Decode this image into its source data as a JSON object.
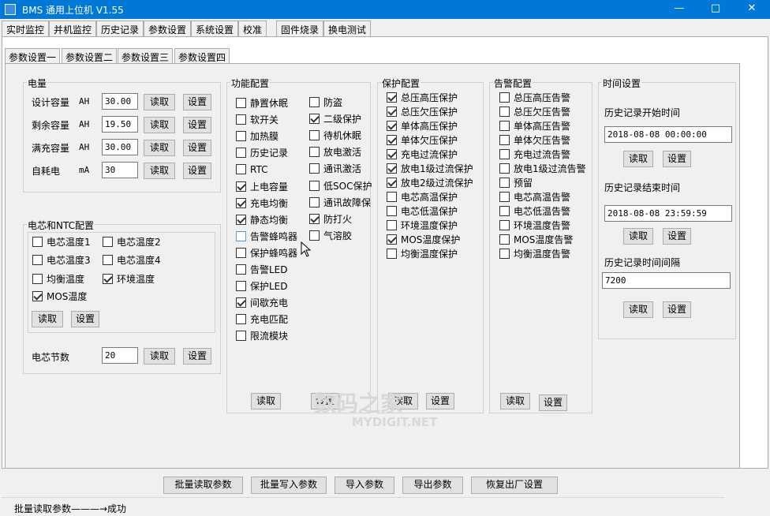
{
  "window": {
    "title": "BMS 通用上位机 V1.55",
    "minimize": "—",
    "maximize": "□",
    "close": "✕"
  },
  "main_tabs": [
    "实时监控",
    "并机监控",
    "历史记录",
    "参数设置",
    "系统设置",
    "校准",
    "固件烧录",
    "换电测试"
  ],
  "sub_tabs": [
    "参数设置一",
    "参数设置二",
    "参数设置三",
    "参数设置四"
  ],
  "buttons": {
    "read": "读取",
    "set": "设置"
  },
  "capacity": {
    "title": "电量",
    "rows": [
      {
        "label": "设计容量",
        "unit": "AH",
        "value": "30.00"
      },
      {
        "label": "剩余容量",
        "unit": "AH",
        "value": "19.50"
      },
      {
        "label": "满充容量",
        "unit": "AH",
        "value": "30.00"
      },
      {
        "label": "自耗电",
        "unit": "mA",
        "value": "30"
      }
    ]
  },
  "ntc": {
    "title": "电芯和NTC配置",
    "items": [
      {
        "label": "电芯温度1",
        "checked": false
      },
      {
        "label": "电芯温度2",
        "checked": false
      },
      {
        "label": "电芯温度3",
        "checked": false
      },
      {
        "label": "电芯温度4",
        "checked": false
      },
      {
        "label": "均衡温度",
        "checked": false
      },
      {
        "label": "环境温度",
        "checked": true
      },
      {
        "label": "MOS温度",
        "checked": true
      }
    ],
    "cell_count_label": "电芯节数",
    "cell_count_value": "20"
  },
  "function": {
    "title": "功能配置",
    "col1": [
      {
        "label": "静置休眠",
        "checked": false
      },
      {
        "label": "软开关",
        "checked": false
      },
      {
        "label": "加热膜",
        "checked": false
      },
      {
        "label": "历史记录",
        "checked": false
      },
      {
        "label": "RTC",
        "checked": false
      },
      {
        "label": "上电容量",
        "checked": true
      },
      {
        "label": "充电均衡",
        "checked": true
      },
      {
        "label": "静态均衡",
        "checked": true
      },
      {
        "label": "告警蜂鸣器",
        "checked": false
      },
      {
        "label": "保护蜂鸣器",
        "checked": false
      },
      {
        "label": "告警LED",
        "checked": false
      },
      {
        "label": "保护LED",
        "checked": false
      },
      {
        "label": "间歇充电",
        "checked": true
      },
      {
        "label": "充电匹配",
        "checked": false
      },
      {
        "label": "限流模块",
        "checked": false
      }
    ],
    "col2": [
      {
        "label": "防盗",
        "checked": false
      },
      {
        "label": "二级保护",
        "checked": true
      },
      {
        "label": "待机休眠",
        "checked": false
      },
      {
        "label": "放电激活",
        "checked": false
      },
      {
        "label": "通讯激活",
        "checked": false
      },
      {
        "label": "低SOC保护",
        "checked": false
      },
      {
        "label": "通讯故障保",
        "checked": false
      },
      {
        "label": "防打火",
        "checked": true
      },
      {
        "label": "气溶胶",
        "checked": false
      }
    ]
  },
  "protection": {
    "title": "保护配置",
    "items": [
      {
        "label": "总压高压保护",
        "checked": true
      },
      {
        "label": "总压欠压保护",
        "checked": true
      },
      {
        "label": "单体高压保护",
        "checked": true
      },
      {
        "label": "单体欠压保护",
        "checked": true
      },
      {
        "label": "充电过流保护",
        "checked": true
      },
      {
        "label": "放电1级过流保护",
        "checked": true
      },
      {
        "label": "放电2级过流保护",
        "checked": true
      },
      {
        "label": "电芯高温保护",
        "checked": false
      },
      {
        "label": "电芯低温保护",
        "checked": false
      },
      {
        "label": "环境温度保护",
        "checked": false
      },
      {
        "label": "MOS温度保护",
        "checked": true
      },
      {
        "label": "均衡温度保护",
        "checked": false
      }
    ]
  },
  "alarm": {
    "title": "告警配置",
    "items": [
      {
        "label": "总压高压告警",
        "checked": false
      },
      {
        "label": "总压欠压告警",
        "checked": false
      },
      {
        "label": "单体高压告警",
        "checked": false
      },
      {
        "label": "单体欠压告警",
        "checked": false
      },
      {
        "label": "充电过流告警",
        "checked": false
      },
      {
        "label": "放电1级过流告警",
        "checked": false
      },
      {
        "label": "预留",
        "checked": false
      },
      {
        "label": "电芯高温告警",
        "checked": false
      },
      {
        "label": "电芯低温告警",
        "checked": false
      },
      {
        "label": "环境温度告警",
        "checked": false
      },
      {
        "label": "MOS温度告警",
        "checked": false
      },
      {
        "label": "均衡温度告警",
        "checked": false
      }
    ]
  },
  "time": {
    "title": "时间设置",
    "start_label": "历史记录开始时间",
    "start_value": "2018-08-08 00:00:00",
    "end_label": "历史记录结束时间",
    "end_value": "2018-08-08 23:59:59",
    "interval_label": "历史记录时间间隔",
    "interval_value": "7200"
  },
  "bottom_buttons": [
    "批量读取参数",
    "批量写入参数",
    "导入参数",
    "导出参数",
    "恢复出厂设置"
  ],
  "status": "批量读取参数———→成功",
  "watermark": {
    "text": "数码之家",
    "sub": "MYDIGIT.NET"
  }
}
